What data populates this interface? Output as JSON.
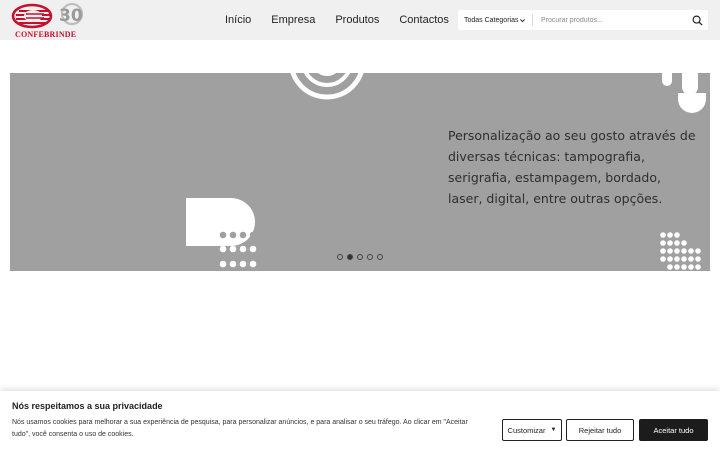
{
  "header": {
    "logo": {
      "brand": "CONFEBRINDE",
      "anniversary": "30",
      "brand_color": "#c8102e"
    },
    "nav": [
      {
        "label": "Início"
      },
      {
        "label": "Empresa"
      },
      {
        "label": "Produtos"
      },
      {
        "label": "Contactos"
      }
    ],
    "search": {
      "category_label": "Todas Categorias",
      "placeholder": "Procurar produtos...",
      "icon": "search-icon"
    }
  },
  "hero": {
    "text": "Personalização ao seu gosto através de diversas técnicas: tampografia, serigrafia, estampagem, bordado, laser, digital, entre outras opções.",
    "background": "#a0a0a0",
    "slides_count": 5,
    "active_slide": 2
  },
  "cookie_banner": {
    "title": "Nós respeitamos a sua privacidade",
    "text": "Nós usamos cookies para melhorar a sua experiência de pesquisa, para personalizar anúncios, e para analisar o seu tráfego. Ao clicar em \"Aceitar tudo\", você consenta o uso de cookies.",
    "customize_label": "Customizar",
    "reject_label": "Rejeitar tudo",
    "accept_label": "Aceitar tudo"
  }
}
